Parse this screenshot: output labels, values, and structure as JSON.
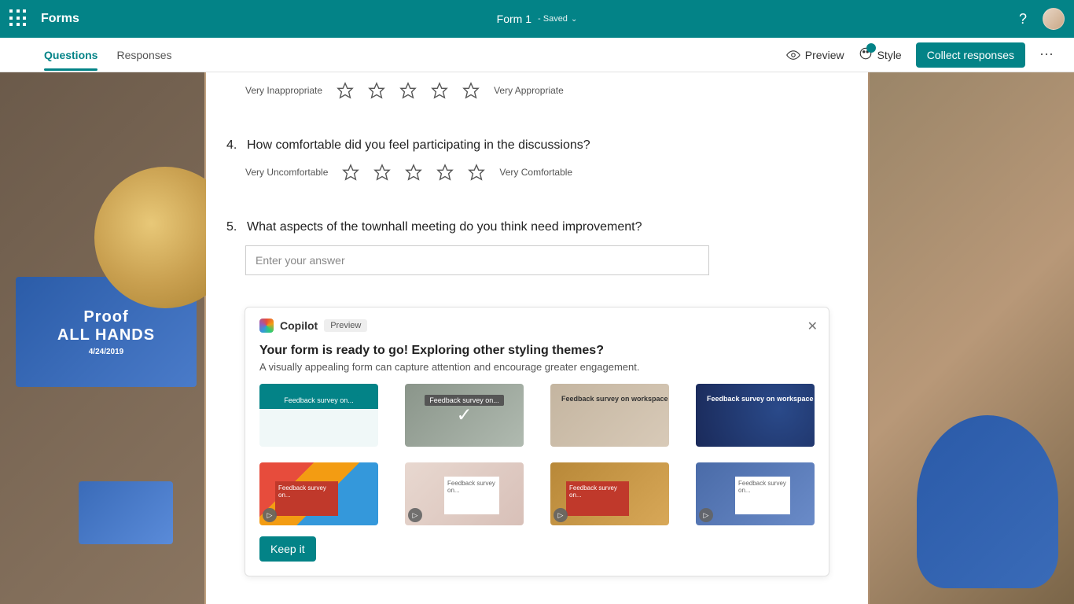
{
  "header": {
    "brand": "Forms",
    "title": "Form 1",
    "saved_status": "- Saved"
  },
  "toolbar": {
    "tabs": {
      "questions": "Questions",
      "responses": "Responses"
    },
    "preview": "Preview",
    "style": "Style",
    "collect": "Collect responses"
  },
  "questions": {
    "q3": {
      "left_label": "Very Inappropriate",
      "right_label": "Very Appropriate"
    },
    "q4": {
      "num": "4.",
      "text": "How comfortable did you feel participating in the discussions?",
      "left_label": "Very Uncomfortable",
      "right_label": "Very Comfortable"
    },
    "q5": {
      "num": "5.",
      "text": "What aspects of the townhall meeting do you think need improvement?",
      "placeholder": "Enter your answer"
    }
  },
  "copilot": {
    "title": "Copilot",
    "badge": "Preview",
    "heading": "Your form is ready to go! Exploring other styling themes?",
    "subheading": "A visually appealing form can capture attention and encourage greater engagement.",
    "themes": {
      "t1": "Feedback survey on...",
      "t2": "Feedback survey on...",
      "t3": "Feedback survey on workspace",
      "t4": "Feedback survey on workspace",
      "t5": "Feedback survey on...",
      "t6": "Feedback survey on...",
      "t7": "Feedback survey on...",
      "t8": "Feedback survey on..."
    },
    "keep_btn": "Keep it"
  },
  "bg": {
    "screen_big": "Proof",
    "screen_sub1": "ALL HANDS",
    "screen_sub2": "4/24/2019"
  }
}
